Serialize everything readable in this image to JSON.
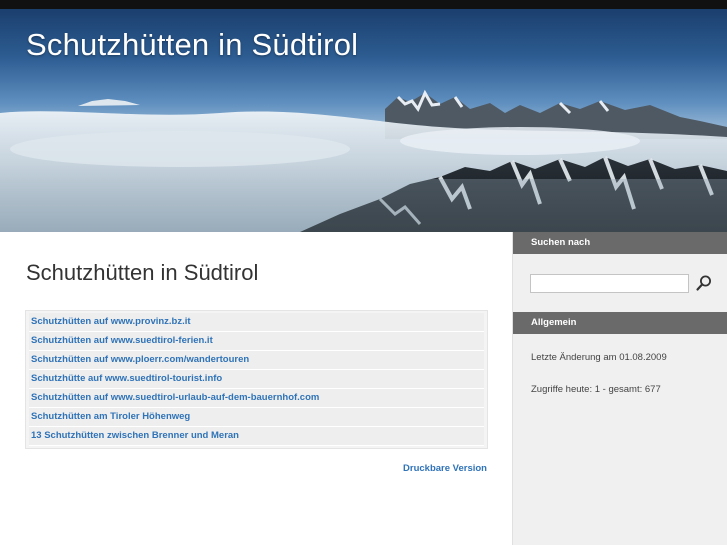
{
  "header": {
    "site_title": "Schutzhütten in Südtirol"
  },
  "main": {
    "heading": "Schutzhütten in Südtirol",
    "links": [
      "Schutzhütten auf www.provinz.bz.it",
      "Schutzhütten auf www.suedtirol-ferien.it",
      "Schutzhütten auf www.ploerr.com/wandertouren",
      "Schutzhütte auf www.suedtirol-tourist.info",
      "Schutzhütten auf www.suedtirol-urlaub-auf-dem-bauernhof.com",
      "Schutzhütten am Tiroler Höhenweg",
      "13 Schutzhütten zwischen Brenner und Meran"
    ],
    "print_link": "Druckbare Version"
  },
  "sidebar": {
    "search_header": "Suchen nach",
    "search_icon": "magnifier-icon",
    "general_header": "Allgemein",
    "last_change": "Letzte Änderung am 01.08.2009",
    "visits": "Zugriffe heute: 1 - gesamt: 677"
  },
  "colors": {
    "link": "#2f73b8",
    "sidebar_header_bg": "#6a6a6a",
    "sidebar_bg": "#f0f0f0"
  }
}
